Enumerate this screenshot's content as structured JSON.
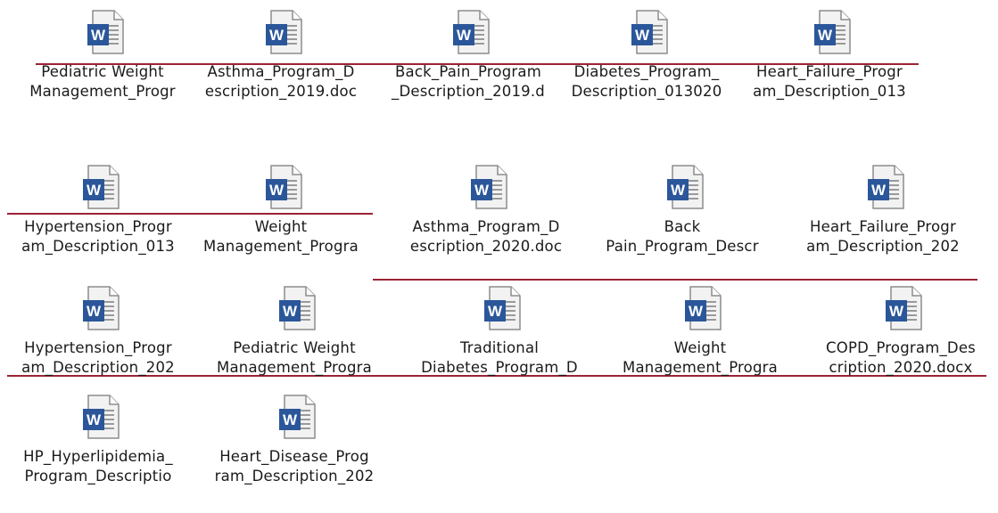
{
  "icon": {
    "name": "word-document-icon",
    "accent": "#2b579a",
    "page": "#f2f2f2",
    "separator": "#9b2335"
  },
  "rows": [
    {
      "items": [
        {
          "line1": "Pediatric Weight",
          "line2": "Management_Progr"
        },
        {
          "line1": "Asthma_Program_D",
          "line2": "escription_2019.doc"
        },
        {
          "line1": "Back_Pain_Program",
          "line2": "_Description_2019.d"
        },
        {
          "line1": "Diabetes_Program_",
          "line2": "Description_013020"
        },
        {
          "line1": "Heart_Failure_Progr",
          "line2": "am_Description_013"
        }
      ]
    },
    {
      "items": [
        {
          "line1": "Hypertension_Progr",
          "line2": "am_Description_013"
        },
        {
          "line1": "Weight",
          "line2": "Management_Progra"
        },
        {
          "line1": "Asthma_Program_D",
          "line2": "escription_2020.doc"
        },
        {
          "line1": "Back",
          "line2": "Pain_Program_Descr"
        },
        {
          "line1": "Heart_Failure_Progr",
          "line2": "am_Description_202"
        }
      ]
    },
    {
      "items": [
        {
          "line1": "Hypertension_Progr",
          "line2": "am_Description_202"
        },
        {
          "line1": "Pediatric Weight",
          "line2": "Management_Progra"
        },
        {
          "line1": "Traditional",
          "line2": "Diabetes_Program_D"
        },
        {
          "line1": "Weight",
          "line2": "Management_Progra"
        },
        {
          "line1": "COPD_Program_Des",
          "line2": "cription_2020.docx"
        }
      ]
    },
    {
      "items": [
        {
          "line1": "HP_Hyperlipidemia_",
          "line2": "Program_Descriptio"
        },
        {
          "line1": "Heart_Disease_Prog",
          "line2": "ram_Description_202"
        }
      ]
    }
  ]
}
